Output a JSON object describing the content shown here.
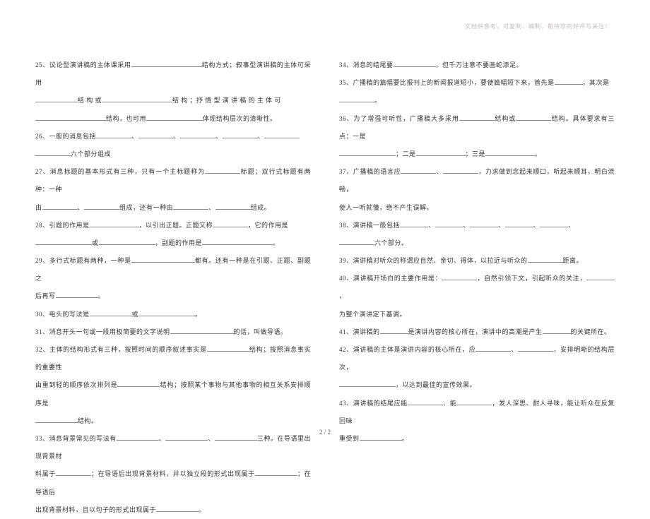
{
  "header": {
    "note": "文档供参考，可复制、编制，期待您的好评与关注！"
  },
  "left_column": {
    "q25_a": "25、议论型演讲稿的主体课采用",
    "q25_b": "结构方式；叙事型演讲稿的主体可采用",
    "q25_c": "结 构 或",
    "q25_d": "结 构 ；抒 情 型 演 讲 稿 的 主 体 可",
    "q25_e": "结构，也可用",
    "q25_f": "体现结构层次的清晰性。",
    "q26_a": "26、一般的消息包括",
    "q26_b": "、",
    "q26_c": "、",
    "q26_d": "、",
    "q26_e": "、",
    "q26_f": "六个部分组成",
    "q27_a": "27、消息标题的基本形式有三种，只有一个主标题称为",
    "q27_b": "标题；双行式标题有两种：一种",
    "q27_c": "由",
    "q27_d": "、",
    "q27_e": "组成，还有一种由",
    "q27_f": "、",
    "q27_g": "组成。",
    "q28_a": "28、引题的作用是",
    "q28_b": "，以引出正题。正题又称",
    "q28_c": "，它的作用是",
    "q28_d": "或",
    "q28_e": "，副题的作用是",
    "q28_f": "。",
    "q29_a": "29、多行式标题有两种，一种是",
    "q29_b": "都有。还有一种是在引题、正题、副题之",
    "q29_c": "后再写",
    "q29_d": "。",
    "q30_a": "30、电头的写法是",
    "q30_b": "或",
    "q30_c": "。",
    "q31_a": "31、消息开头一句或一段用极简要的文字说明",
    "q31_b": "的话，叫做导语。",
    "q32_a": "32、主体的结构形式有三种，按照时间的顺序叙述事实是",
    "q32_b": "结构；按照消息事实的重要性",
    "q32_c": "由重到轻的顺序依次排列是",
    "q32_d": "结构；按照某个事物与其他事物的相互关系安排顺序是",
    "q32_e": "结构。",
    "q33_a": "33、消息背景常见的写法有",
    "q33_b": "、",
    "q33_c": "、",
    "q33_d": "三种。在导语里出现背景材",
    "q33_e": "料属于",
    "q33_f": "；在导语后出现背景材料，并以独立段的形式出现属于",
    "q33_g": "；在导语后",
    "q33_h": "出现背景材料，且以句子的形式出现属于",
    "q33_i": "。"
  },
  "right_column": {
    "q34_a": "34、消息的结尾要",
    "q34_b": "，但千万注意不要画蛇添足。",
    "q35_a": "35、广播稿的篇幅要比报刊上的新闻报道短小，要使篇幅短下来，首先是",
    "q35_b": "，其次是",
    "q35_c": "。",
    "q36_a": "36、为了增强可听性，广播稿大多采用",
    "q36_b": "结构或",
    "q36_c": "结构。具体要求有三点：一是",
    "q36_d": "；二是",
    "q36_e": "；三是",
    "q36_f": "。",
    "q37_a": "37、广播稿的语言应",
    "q37_b": "、",
    "q37_c": "，力求做到念起来顺口，听起来顺耳，明白流畅，",
    "q37_d": "使人一听就懂，绝不产生误解。",
    "q38_a": "38、演讲稿一般包括",
    "q38_b": "、",
    "q38_c": "、",
    "q38_d": "、",
    "q38_e": "、",
    "q38_f": "、",
    "q38_g": "六个部分。",
    "q39_a": "39、演讲稿对听众的称谓应自然、亲切、得体，以拉近与听众的",
    "q39_b": "距离。",
    "q40_a": "40、演讲稿开场白的主要作用是：",
    "q40_b": "，自然引领下文，引起听众的关注，",
    "q40_c": "，",
    "q40_d": "为整个演讲定下基调。",
    "q41_a": "41、演讲稿的",
    "q41_b": "是演讲内容的核心所在，演讲中的高潮是产生",
    "q41_c": "的关键所在。",
    "q42_a": "42、演讲稿的主体是演讲内容的核心所在，应",
    "q42_b": "、",
    "q42_c": "，安排明晰的结构层次，",
    "q42_d": "，以达到最佳的宣传效果。",
    "q43_a": "43、演讲稿的结尾应能",
    "q43_b": "、能",
    "q43_c": "，发人深思、耐人寻味，能让听众在反复回味",
    "q43_d": "重受到",
    "q43_e": "。"
  },
  "footer": {
    "page": "2 / 2"
  }
}
